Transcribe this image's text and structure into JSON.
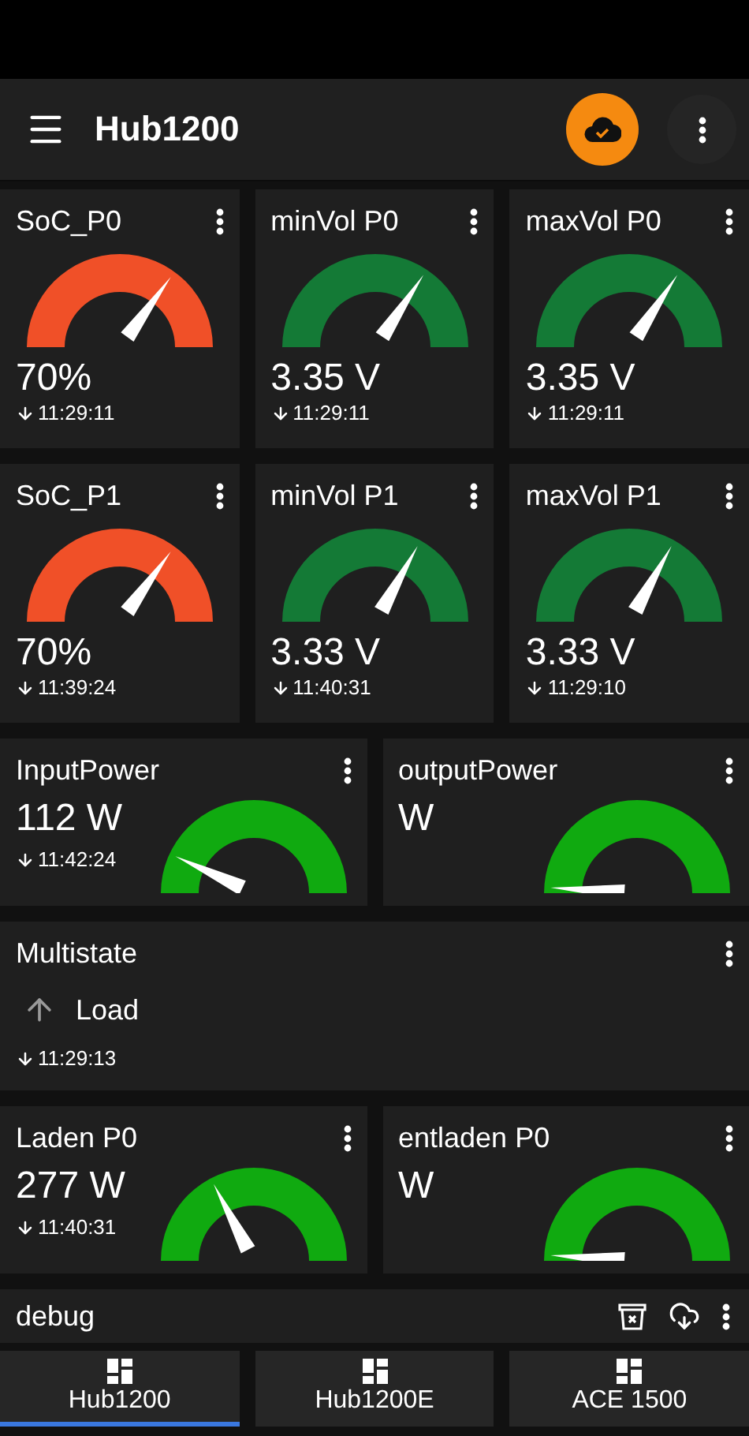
{
  "app_bar": {
    "title": "Hub1200"
  },
  "rows": [
    {
      "widgets": [
        {
          "kind": "percent_gauge",
          "title": "SoC_P0",
          "value": "70%",
          "time": "11:29:11",
          "color": "#f05028"
        },
        {
          "kind": "voltage_gauge",
          "title": "minVol P0",
          "value": "3.35 V",
          "time": "11:29:11",
          "color": "#147a36"
        },
        {
          "kind": "voltage_gauge",
          "title": "maxVol P0",
          "value": "3.35 V",
          "time": "11:29:11",
          "color": "#147a36"
        }
      ]
    },
    {
      "widgets": [
        {
          "kind": "percent_gauge",
          "title": "SoC_P1",
          "value": "70%",
          "time": "11:39:24",
          "color": "#f05028"
        },
        {
          "kind": "voltage_gauge",
          "title": "minVol P1",
          "value": "3.33 V",
          "time": "11:40:31",
          "color": "#147a36"
        },
        {
          "kind": "voltage_gauge",
          "title": "maxVol P1",
          "value": "3.33 V",
          "time": "11:29:10",
          "color": "#147a36"
        }
      ]
    },
    {
      "widgets": [
        {
          "kind": "power_gauge",
          "title": "InputPower",
          "value": "112 W",
          "time": "11:42:24",
          "color": "#10aa10"
        },
        {
          "kind": "power_gauge",
          "title": "outputPower",
          "value": "W",
          "color": "#10aa10"
        }
      ]
    },
    {
      "widgets": [
        {
          "kind": "multistate",
          "title": "Multistate",
          "state": "Load",
          "time": "11:29:13"
        }
      ]
    },
    {
      "widgets": [
        {
          "kind": "power_gauge",
          "title": "Laden P0",
          "value": "277 W",
          "time": "11:40:31",
          "color": "#10aa10"
        },
        {
          "kind": "power_gauge",
          "title": "entladen P0",
          "value": "W",
          "color": "#10aa10"
        }
      ]
    }
  ],
  "debug": {
    "title": "debug"
  },
  "tabs": [
    {
      "label": "Hub1200",
      "selected": true
    },
    {
      "label": "Hub1200E",
      "selected": false
    },
    {
      "label": "ACE 1500",
      "selected": false
    }
  ]
}
